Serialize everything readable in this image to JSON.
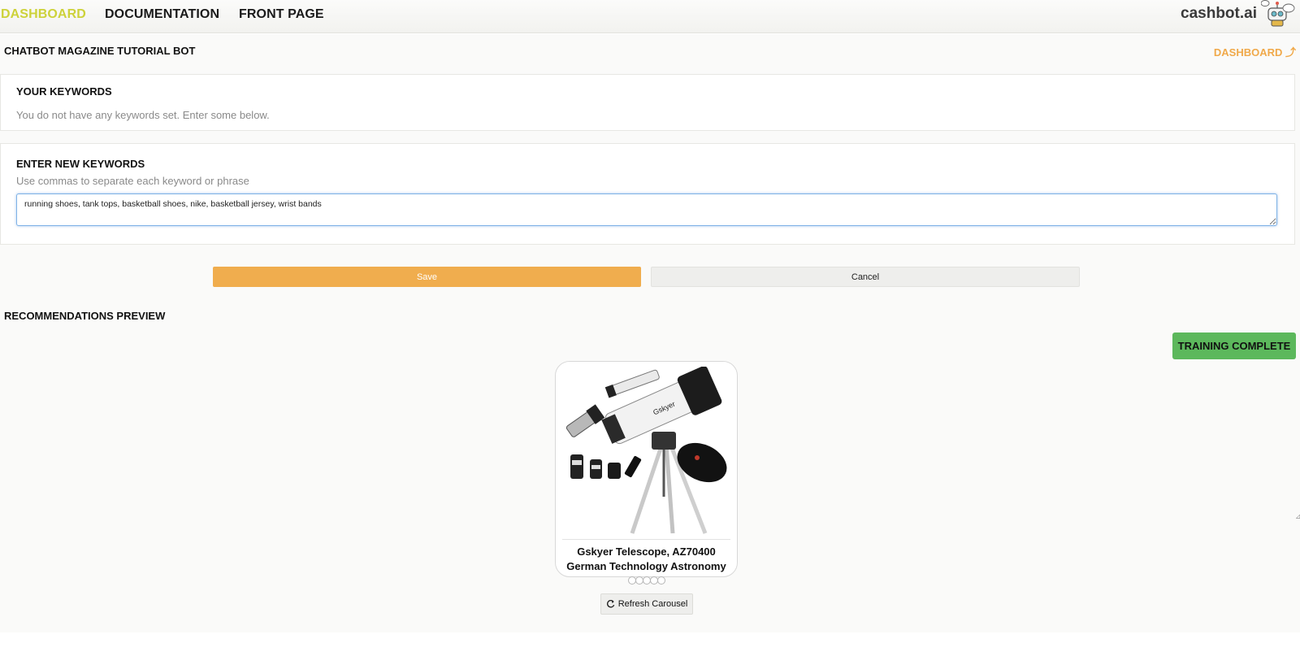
{
  "nav": {
    "items": [
      {
        "label": "DASHBOARD",
        "active": true
      },
      {
        "label": "DOCUMENTATION",
        "active": false
      },
      {
        "label": "FRONT PAGE",
        "active": false
      }
    ],
    "brand": "cashbot.ai",
    "active_color": "#cdd23a"
  },
  "header": {
    "title": "CHATBOT MAGAZINE TUTORIAL BOT",
    "dashboard_link": "DASHBOARD ⤴",
    "link_color": "#f0a94a"
  },
  "keywords_panel": {
    "heading": "YOUR KEYWORDS",
    "empty_text": "You do not have any keywords set. Enter some below."
  },
  "new_keywords_panel": {
    "heading": "ENTER NEW KEYWORDS",
    "hint": "Use commas to separate each keyword or phrase",
    "input_value": "running shoes, tank tops, basketball shoes, nike, basketball jersey, wrist bands"
  },
  "actions": {
    "save_label": "Save",
    "cancel_label": "Cancel",
    "save_color": "#f0ad4e"
  },
  "recommendations": {
    "heading": "RECOMMENDATIONS PREVIEW",
    "status_badge": "TRAINING COMPLETE",
    "status_color": "#5cb85c",
    "product": {
      "title_line1": "Gskyer Telescope, AZ70400",
      "title_line2": "German Technology Astronomy",
      "image_icon": "telescope-image",
      "brand_text": "Gskyer"
    },
    "carousel_pages": 5,
    "refresh_label": "Refresh Carousel"
  }
}
